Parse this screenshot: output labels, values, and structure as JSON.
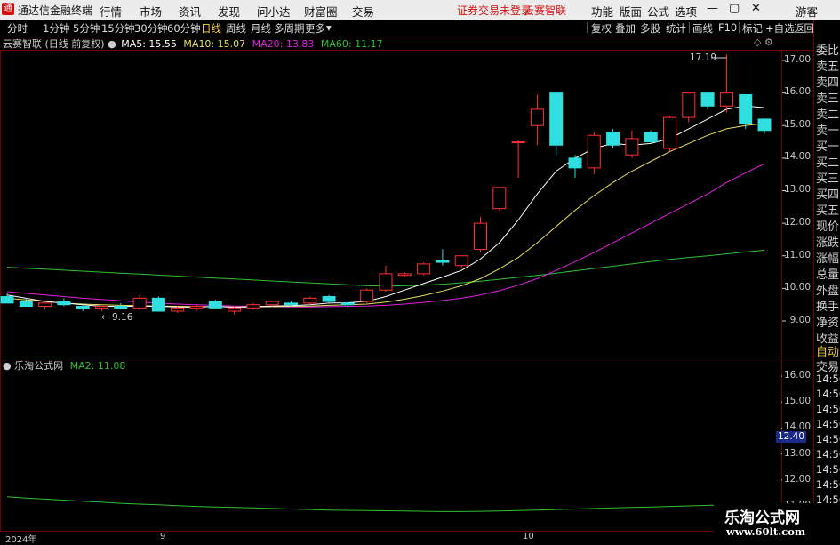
{
  "app": {
    "title": "通达信金融终端"
  },
  "menu": {
    "items": [
      "行情",
      "市场",
      "资讯",
      "发现",
      "问小达",
      "财富圈",
      "交易"
    ],
    "notice": "证券交易未登录",
    "notice2": "云赛智联",
    "right": [
      "功能",
      "版面",
      "公式",
      "选项"
    ],
    "user": "游客"
  },
  "periods": {
    "items": [
      "分时",
      "1分钟",
      "5分钟",
      "15分钟",
      "30分钟",
      "60分钟",
      "日线",
      "周线",
      "月线",
      "多周期",
      "更多"
    ],
    "active": "日线"
  },
  "tools": [
    "复权",
    "叠加",
    "多股",
    "统计",
    "画线",
    "F10",
    "标记",
    "+自选",
    "返回"
  ],
  "stock": {
    "name": "云赛智联",
    "mode": "(日线 前复权)"
  },
  "ma": {
    "ma5": "MA5: 15.55",
    "ma10": "MA10: 15.07",
    "ma20": "MA20: 13.83",
    "ma60": "MA60: 11.17",
    "colors": {
      "ma5": "#ffffff",
      "ma10": "#e6e060",
      "ma20": "#e020e0",
      "ma60": "#30c030"
    }
  },
  "indicator": {
    "name": "乐淘公式网",
    "ma2": "MA2: 11.08"
  },
  "price_axis": [
    "17.00",
    "16.00",
    "15.00",
    "14.00",
    "13.00",
    "12.00",
    "11.00",
    "10.00",
    "9.00"
  ],
  "ind_axis": [
    "16.00",
    "15.00",
    "14.00",
    "13.00",
    "12.00",
    "11.00"
  ],
  "ind_current": "12.40",
  "annotations": {
    "high": "17.19",
    "low": "9.16"
  },
  "date_axis": {
    "start": "2024年",
    "m9": "9",
    "m10": "10"
  },
  "side_labels": [
    "委比",
    "卖五",
    "卖四",
    "卖三",
    "卖二",
    "卖一",
    "买一",
    "买二",
    "买三",
    "买四",
    "买五",
    "现价",
    "涨跌",
    "涨幅",
    "总量",
    "外盘",
    "换手",
    "净资",
    "收益"
  ],
  "side_bottom": [
    "自动",
    "交易",
    "14:56",
    "14:56",
    "14:56",
    "14:56",
    "14:56",
    "14:56",
    "14:56",
    "14:56",
    "14:56"
  ],
  "watermark": {
    "line1": "乐淘公式网",
    "line2": "www.60lt.com"
  },
  "chart_data": {
    "type": "candlestick",
    "ylim": [
      8.6,
      17.6
    ],
    "up_color": "#ff3030",
    "down_color": "#30e0e0",
    "candles": [
      {
        "o": 9.75,
        "h": 9.85,
        "l": 9.55,
        "c": 9.55
      },
      {
        "o": 9.6,
        "h": 9.7,
        "l": 9.45,
        "c": 9.45
      },
      {
        "o": 9.45,
        "h": 9.55,
        "l": 9.35,
        "c": 9.55
      },
      {
        "o": 9.6,
        "h": 9.7,
        "l": 9.45,
        "c": 9.5
      },
      {
        "o": 9.45,
        "h": 9.5,
        "l": 9.3,
        "c": 9.38
      },
      {
        "o": 9.4,
        "h": 9.5,
        "l": 9.3,
        "c": 9.45
      },
      {
        "o": 9.45,
        "h": 9.55,
        "l": 9.35,
        "c": 9.38
      },
      {
        "o": 9.4,
        "h": 9.8,
        "l": 9.35,
        "c": 9.7
      },
      {
        "o": 9.7,
        "h": 9.75,
        "l": 9.3,
        "c": 9.3
      },
      {
        "o": 9.3,
        "h": 9.45,
        "l": 9.25,
        "c": 9.4
      },
      {
        "o": 9.4,
        "h": 9.5,
        "l": 9.3,
        "c": 9.45
      },
      {
        "o": 9.6,
        "h": 9.65,
        "l": 9.4,
        "c": 9.4
      },
      {
        "o": 9.3,
        "h": 9.45,
        "l": 9.2,
        "c": 9.4
      },
      {
        "o": 9.4,
        "h": 9.55,
        "l": 9.35,
        "c": 9.5
      },
      {
        "o": 9.5,
        "h": 9.6,
        "l": 9.45,
        "c": 9.6
      },
      {
        "o": 9.55,
        "h": 9.6,
        "l": 9.45,
        "c": 9.5
      },
      {
        "o": 9.55,
        "h": 9.75,
        "l": 9.5,
        "c": 9.7
      },
      {
        "o": 9.75,
        "h": 9.8,
        "l": 9.55,
        "c": 9.6
      },
      {
        "o": 9.55,
        "h": 9.6,
        "l": 9.4,
        "c": 9.5
      },
      {
        "o": 9.6,
        "h": 10.0,
        "l": 9.55,
        "c": 9.95
      },
      {
        "o": 9.95,
        "h": 10.7,
        "l": 9.9,
        "c": 10.45
      },
      {
        "o": 10.4,
        "h": 10.5,
        "l": 10.35,
        "c": 10.45
      },
      {
        "o": 10.45,
        "h": 10.8,
        "l": 10.4,
        "c": 10.75
      },
      {
        "o": 10.85,
        "h": 11.2,
        "l": 10.7,
        "c": 10.8
      },
      {
        "o": 10.7,
        "h": 11.0,
        "l": 10.65,
        "c": 11.0
      },
      {
        "o": 11.2,
        "h": 12.2,
        "l": 11.1,
        "c": 12.0
      },
      {
        "o": 12.45,
        "h": 13.1,
        "l": 12.4,
        "c": 13.1
      },
      {
        "o": 14.5,
        "h": 14.55,
        "l": 13.4,
        "c": 14.5
      },
      {
        "o": 15.0,
        "h": 15.95,
        "l": 14.4,
        "c": 15.5
      },
      {
        "o": 16.0,
        "h": 16.0,
        "l": 14.1,
        "c": 14.4
      },
      {
        "o": 14.0,
        "h": 14.1,
        "l": 13.4,
        "c": 13.7
      },
      {
        "o": 13.7,
        "h": 14.8,
        "l": 13.5,
        "c": 14.7
      },
      {
        "o": 14.8,
        "h": 14.9,
        "l": 14.3,
        "c": 14.4
      },
      {
        "o": 14.1,
        "h": 14.85,
        "l": 14.0,
        "c": 14.6
      },
      {
        "o": 14.8,
        "h": 14.85,
        "l": 14.45,
        "c": 14.5
      },
      {
        "o": 14.3,
        "h": 15.3,
        "l": 14.2,
        "c": 15.25
      },
      {
        "o": 15.25,
        "h": 16.0,
        "l": 15.1,
        "c": 16.0
      },
      {
        "o": 16.0,
        "h": 16.0,
        "l": 15.5,
        "c": 15.6
      },
      {
        "o": 15.6,
        "h": 17.19,
        "l": 15.4,
        "c": 16.0
      },
      {
        "o": 15.95,
        "h": 15.95,
        "l": 14.9,
        "c": 15.05
      },
      {
        "o": 15.2,
        "h": 15.2,
        "l": 14.75,
        "c": 14.85
      }
    ],
    "ma5": [
      9.8,
      9.7,
      9.6,
      9.55,
      9.5,
      9.45,
      9.45,
      9.45,
      9.45,
      9.43,
      9.42,
      9.45,
      9.42,
      9.44,
      9.46,
      9.47,
      9.5,
      9.55,
      9.56,
      9.6,
      9.75,
      9.95,
      10.15,
      10.35,
      10.55,
      10.9,
      11.4,
      12.1,
      12.9,
      13.6,
      14.0,
      14.3,
      14.45,
      14.4,
      14.45,
      14.6,
      14.9,
      15.2,
      15.5,
      15.6,
      15.55
    ],
    "ma10": [
      9.7,
      9.65,
      9.6,
      9.55,
      9.52,
      9.5,
      9.48,
      9.47,
      9.46,
      9.45,
      9.44,
      9.44,
      9.43,
      9.43,
      9.44,
      9.45,
      9.46,
      9.48,
      9.5,
      9.52,
      9.58,
      9.67,
      9.78,
      9.92,
      10.08,
      10.3,
      10.6,
      10.95,
      11.4,
      11.9,
      12.4,
      12.85,
      13.25,
      13.6,
      13.9,
      14.2,
      14.45,
      14.7,
      14.9,
      15.0,
      15.07
    ],
    "ma20": [
      9.9,
      9.85,
      9.8,
      9.75,
      9.7,
      9.66,
      9.62,
      9.58,
      9.55,
      9.52,
      9.5,
      9.48,
      9.46,
      9.45,
      9.44,
      9.43,
      9.43,
      9.44,
      9.45,
      9.46,
      9.48,
      9.52,
      9.57,
      9.63,
      9.7,
      9.8,
      9.93,
      10.1,
      10.3,
      10.55,
      10.82,
      11.1,
      11.4,
      11.7,
      12.0,
      12.3,
      12.6,
      12.9,
      13.25,
      13.55,
      13.83
    ],
    "ma60": [
      10.65,
      10.62,
      10.59,
      10.56,
      10.53,
      10.5,
      10.47,
      10.44,
      10.41,
      10.38,
      10.35,
      10.32,
      10.29,
      10.26,
      10.23,
      10.2,
      10.17,
      10.14,
      10.11,
      10.08,
      10.07,
      10.08,
      10.1,
      10.13,
      10.17,
      10.22,
      10.28,
      10.34,
      10.4,
      10.47,
      10.54,
      10.61,
      10.68,
      10.75,
      10.82,
      10.89,
      10.95,
      11.0,
      11.06,
      11.12,
      11.17
    ],
    "ind_ylim": [
      10.5,
      16.4
    ],
    "ind_ma2": [
      11.35,
      11.3,
      11.26,
      11.22,
      11.18,
      11.14,
      11.1,
      11.07,
      11.04,
      11.01,
      10.98,
      10.96,
      10.94,
      10.92,
      10.9,
      10.88,
      10.86,
      10.84,
      10.83,
      10.82,
      10.81,
      10.8,
      10.79,
      10.78,
      10.78,
      10.79,
      10.8,
      10.82,
      10.84,
      10.86,
      10.88,
      10.9,
      10.92,
      10.94,
      10.96,
      10.98,
      11.0,
      11.02,
      11.04,
      11.06,
      11.08
    ]
  }
}
